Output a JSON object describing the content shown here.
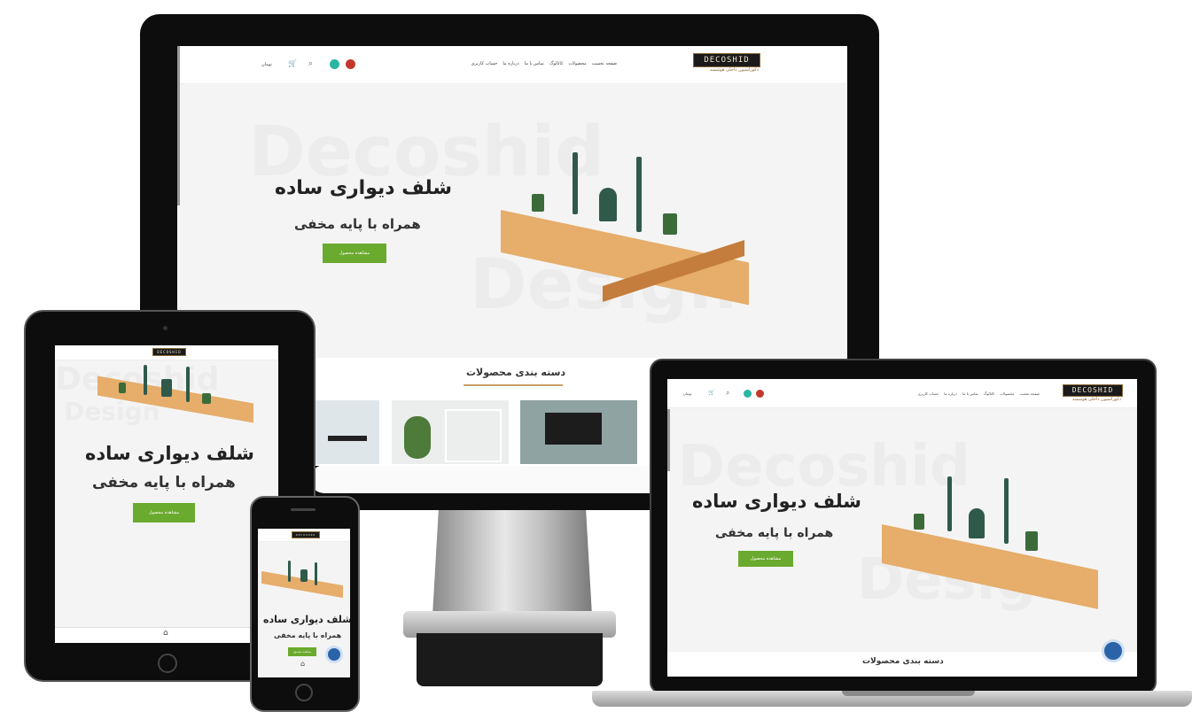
{
  "brand": {
    "logo_text": "DECOSHID",
    "tagline": "دکوراسیون داخلی هوشمند"
  },
  "nav": {
    "links": [
      "صفحه نخست",
      "محصولات",
      "کاتالوگ",
      "تماس با ما",
      "درباره ما",
      "حساب کاربری"
    ],
    "cart_label": "تومان"
  },
  "hero": {
    "title": "شلف دیواری ساده",
    "subtitle": "همراه با پایه مخفی",
    "cta_label": "مشاهده محصول",
    "watermark_line1": "Decoshid",
    "watermark_line2": "Design"
  },
  "categories": {
    "title": "دسته بندی محصولات"
  },
  "icons": [
    "search-icon",
    "cart-icon",
    "whatsapp-icon",
    "instagram-icon",
    "help-icon",
    "home-icon"
  ],
  "colors": {
    "accent_green": "#6aaa2e",
    "logo_gold": "#c8a065",
    "device_black": "#0d0d0d",
    "help_blue": "#2b63a8"
  }
}
